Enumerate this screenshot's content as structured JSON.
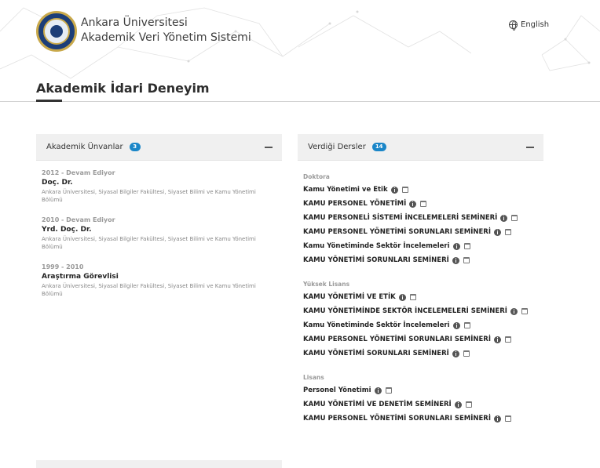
{
  "header": {
    "university": "Ankara Üniversitesi",
    "system": "Akademik Veri Yönetim Sistemi",
    "language": "English",
    "logo_icon": "university-seal-icon"
  },
  "page": {
    "title": "Akademik İdari Deneyim"
  },
  "unvanlar": {
    "label": "Akademik Ünvanlar",
    "count": "3",
    "items": [
      {
        "date": "2012 - Devam Ediyor",
        "title": "Doç. Dr.",
        "desc": "Ankara Üniversitesi, Siyasal Bilgiler Fakültesi, Siyaset Bilimi ve Kamu Yönetimi Bölümü"
      },
      {
        "date": "2010 - Devam Ediyor",
        "title": "Yrd. Doç. Dr.",
        "desc": "Ankara Üniversitesi, Siyasal Bilgiler Fakültesi, Siyaset Bilimi ve Kamu Yönetimi Bölümü"
      },
      {
        "date": "1999 - 2010",
        "title": "Araştırma Görevlisi",
        "desc": "Ankara Üniversitesi, Siyasal Bilgiler Fakültesi, Siyaset Bilimi ve Kamu Yönetimi Bölümü"
      }
    ]
  },
  "dersler": {
    "label": "Verdiği Dersler",
    "count": "14",
    "groups": [
      {
        "label": "Doktora",
        "courses": [
          "Kamu Yönetimi ve Etik",
          "KAMU PERSONEL YÖNETİMİ",
          "KAMU PERSONELİ SİSTEMİ İNCELEMELERİ SEMİNERİ",
          "KAMU PERSONEL YÖNETİMİ SORUNLARI SEMİNERİ",
          "Kamu Yönetiminde Sektör İncelemeleri",
          "KAMU YÖNETİMİ SORUNLARI SEMİNERİ"
        ]
      },
      {
        "label": "Yüksek Lisans",
        "courses": [
          "KAMU YÖNETİMİ VE ETİK",
          "KAMU YÖNETİMİNDE SEKTÖR İNCELEMELERİ SEMİNERİ",
          "Kamu Yönetiminde Sektör İncelemeleri",
          "KAMU PERSONEL YÖNETİMİ SORUNLARI SEMİNERİ",
          "KAMU YÖNETİMİ SORUNLARI SEMİNERİ"
        ]
      },
      {
        "label": "Lisans",
        "courses": [
          "Personel Yönetimi",
          "KAMU YÖNETİMİ VE DENETİM SEMİNERİ",
          "KAMU PERSONEL YÖNETİMİ SORUNLARI SEMİNERİ"
        ]
      }
    ]
  },
  "colors": {
    "badge": "#1a86c8",
    "panel_head": "#f0f0f0",
    "seal_blue": "#1c3e78",
    "seal_gold": "#c9a94b"
  }
}
